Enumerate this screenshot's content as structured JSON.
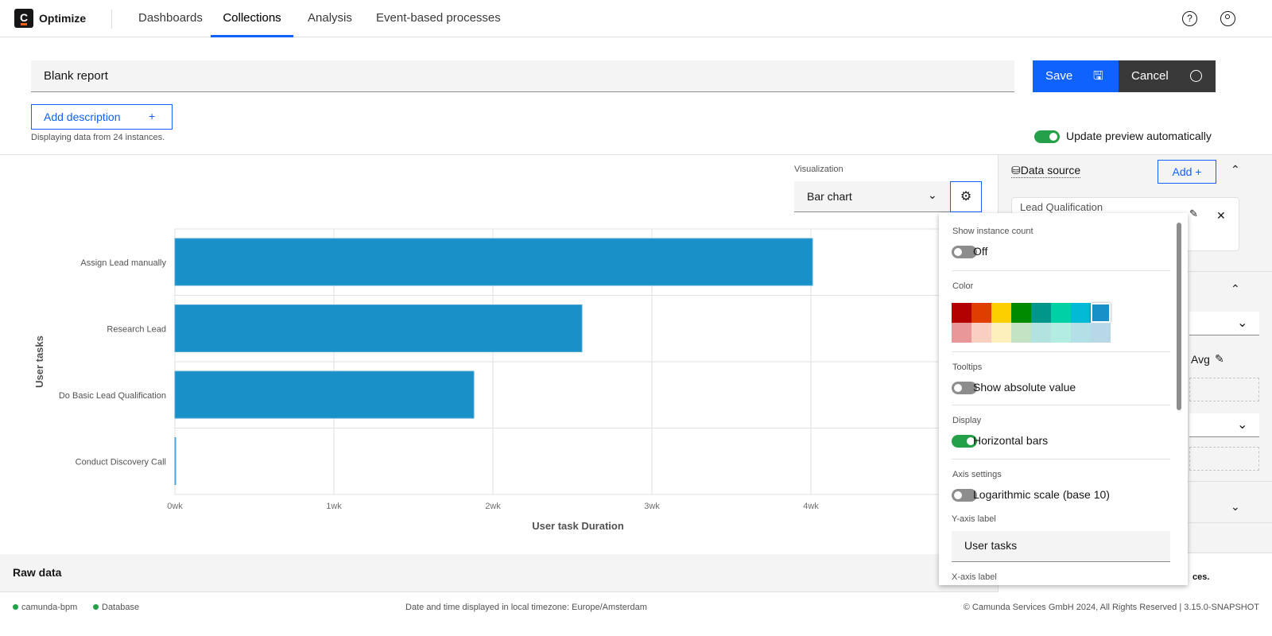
{
  "nav": {
    "brand": "Optimize",
    "logo_letter": "C",
    "tabs": [
      "Dashboards",
      "Collections",
      "Analysis",
      "Event-based processes"
    ],
    "active_tab": "Collections"
  },
  "report": {
    "title": "Blank report",
    "add_description": "Add description",
    "add_icon": "+",
    "instances_note": "Displaying data from 24 instances.",
    "save": "Save",
    "cancel": "Cancel",
    "update_preview": "Update preview automatically"
  },
  "visualization": {
    "label": "Visualization",
    "selected": "Bar chart"
  },
  "chart_data": {
    "type": "bar",
    "orientation": "horizontal",
    "categories": [
      "Assign Lead manually",
      "Research Lead",
      "Do Basic Lead Qualification",
      "Conduct Discovery Call"
    ],
    "values": [
      4.01,
      2.56,
      1.88,
      0.005
    ],
    "unit": "wk",
    "xticks": [
      "0wk",
      "1wk",
      "2wk",
      "3wk",
      "4wk"
    ],
    "xlim": [
      0,
      4.8
    ],
    "xlabel": "User task Duration",
    "ylabel": "User tasks",
    "color": "#1991c8",
    "grid": true
  },
  "popover": {
    "instance_count_label": "Show instance count",
    "instance_count_value": "Off",
    "color_label": "Color",
    "colors_top": [
      "#b30000",
      "#de3e00",
      "#fccf00",
      "#008a00",
      "#00968a",
      "#00d1a5",
      "#00bad6",
      "#1991c8"
    ],
    "colors_bottom": [
      "#e89898",
      "#f9cfc2",
      "#fdf0bd",
      "#c4e2c4",
      "#b3e3e0",
      "#b3ede1",
      "#b3dfe6",
      "#b8d7e7"
    ],
    "selected_color": "#1991c8",
    "tooltips_label": "Tooltips",
    "tooltips_option": "Show absolute value",
    "display_label": "Display",
    "display_option": "Horizontal bars",
    "axis_label": "Axis settings",
    "axis_option": "Logarithmic scale (base 10)",
    "y_axis_label": "Y-axis label",
    "y_axis_value": "User tasks",
    "x_axis_label": "X-axis label"
  },
  "sidebar": {
    "data_source": "Data source",
    "add": "Add +",
    "card_title": "Lead Qualification",
    "avg": "Avg",
    "note_tail": "ces."
  },
  "raw_data": "Raw data",
  "footer": {
    "engine": "camunda-bpm",
    "database": "Database",
    "timezone": "Date and time displayed in local timezone: Europe/Amsterdam",
    "copyright": "© Camunda Services GmbH 2024, All Rights Reserved | 3.15.0-SNAPSHOT"
  }
}
